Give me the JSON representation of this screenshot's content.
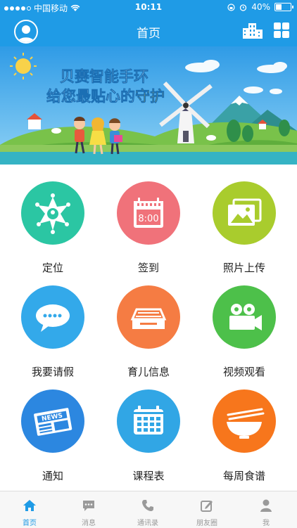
{
  "status_bar": {
    "carrier": "中国移动",
    "time": "10:11",
    "battery": "40%"
  },
  "header": {
    "title": "首页"
  },
  "banner": {
    "line1": "贝赛智能手环",
    "line2_prefix": "给您最贴心的",
    "line2_highlight": "守护"
  },
  "features": [
    {
      "label": "定位",
      "icon": "locator-badge-icon",
      "color": "#2bc6a3"
    },
    {
      "label": "签到",
      "icon": "calendar-clock-icon",
      "color": "#f0727a"
    },
    {
      "label": "照片上传",
      "icon": "photos-icon",
      "color": "#a9cc2d"
    },
    {
      "label": "我要请假",
      "icon": "chat-bubble-icon",
      "color": "#33a9ea"
    },
    {
      "label": "育儿信息",
      "icon": "inbox-tray-icon",
      "color": "#f57c43"
    },
    {
      "label": "视频观看",
      "icon": "video-camera-icon",
      "color": "#4dc04a"
    },
    {
      "label": "通知",
      "icon": "newspaper-icon",
      "color": "#2c87e0"
    },
    {
      "label": "课程表",
      "icon": "timetable-icon",
      "color": "#31a6e5"
    },
    {
      "label": "每周食谱",
      "icon": "food-bowl-icon",
      "color": "#f7761c"
    }
  ],
  "tabs": [
    {
      "label": "首页",
      "icon": "home-icon"
    },
    {
      "label": "消息",
      "icon": "message-icon"
    },
    {
      "label": "通讯录",
      "icon": "phone-icon"
    },
    {
      "label": "朋友圈",
      "icon": "edit-icon"
    },
    {
      "label": "我",
      "icon": "person-icon"
    }
  ],
  "colors": {
    "primary": "#1f9be6",
    "tab_active": "#1f9be6",
    "tab_inactive": "#9a9a9a"
  }
}
